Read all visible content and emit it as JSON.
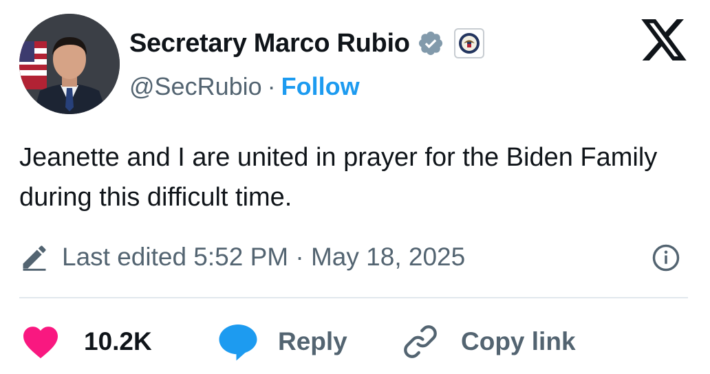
{
  "author": {
    "name": "Secretary Marco Rubio",
    "handle": "@SecRubio",
    "separator": "·",
    "follow_label": "Follow"
  },
  "tweet": {
    "text": "Jeanette and I are united in prayer for the Biden Family during this difficult time."
  },
  "meta": {
    "edited_text": "Last edited 5:52 PM · May 18, 2025"
  },
  "actions": {
    "like_count": "10.2K",
    "reply_label": "Reply",
    "copy_label": "Copy link"
  },
  "colors": {
    "accent": "#1d9bf0",
    "muted": "#536471",
    "heart": "#f91880",
    "verified_gray": "#829aab",
    "text": "#0f1419"
  }
}
